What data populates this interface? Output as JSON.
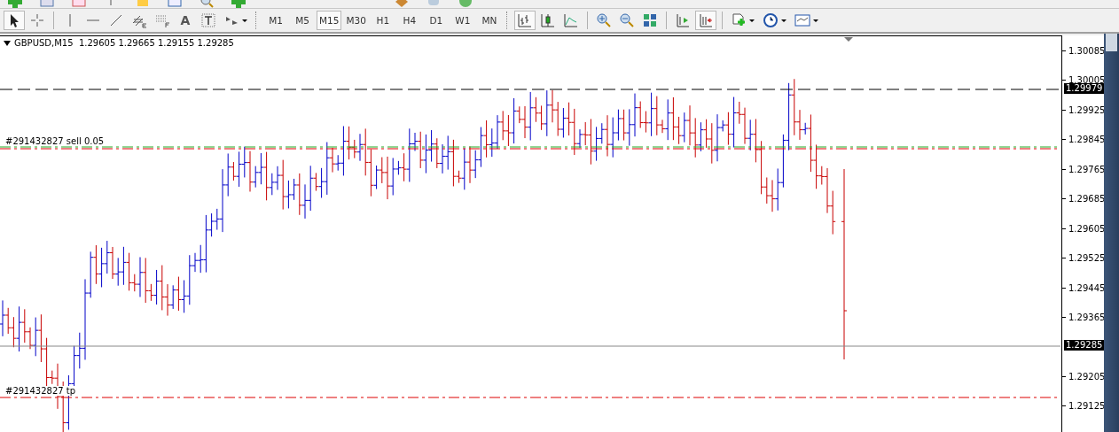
{
  "toolbar": {
    "text_tool_glyph": "A",
    "timeframes": [
      {
        "label": "M1",
        "selected": false
      },
      {
        "label": "M5",
        "selected": false
      },
      {
        "label": "M15",
        "selected": true
      },
      {
        "label": "M30",
        "selected": false
      },
      {
        "label": "H1",
        "selected": false
      },
      {
        "label": "H4",
        "selected": false
      },
      {
        "label": "D1",
        "selected": false
      },
      {
        "label": "W1",
        "selected": false
      },
      {
        "label": "MN",
        "selected": false
      }
    ],
    "chart_types": [
      {
        "kind": "bars",
        "selected": true
      },
      {
        "kind": "candles",
        "selected": false
      },
      {
        "kind": "line",
        "selected": false
      }
    ],
    "chart_shift": {
      "selected": true
    }
  },
  "chart": {
    "header": "GBPUSD,M15  1.29605 1.29665 1.29155 1.29285",
    "order_labels": [
      {
        "kind": "entry",
        "text": "#291432827 sell 0.05"
      },
      {
        "kind": "tp",
        "text": "#291432827 tp"
      }
    ],
    "price_axis": [
      "1.30085",
      "1.30005",
      "1.29925",
      "1.29845",
      "1.29765",
      "1.29685",
      "1.29605",
      "1.29525",
      "1.29445",
      "1.29365",
      "1.29205",
      "1.29125"
    ],
    "price_markers": [
      {
        "kind": "line",
        "text": "1.29979"
      },
      {
        "kind": "bid",
        "text": "1.29285"
      }
    ]
  }
}
